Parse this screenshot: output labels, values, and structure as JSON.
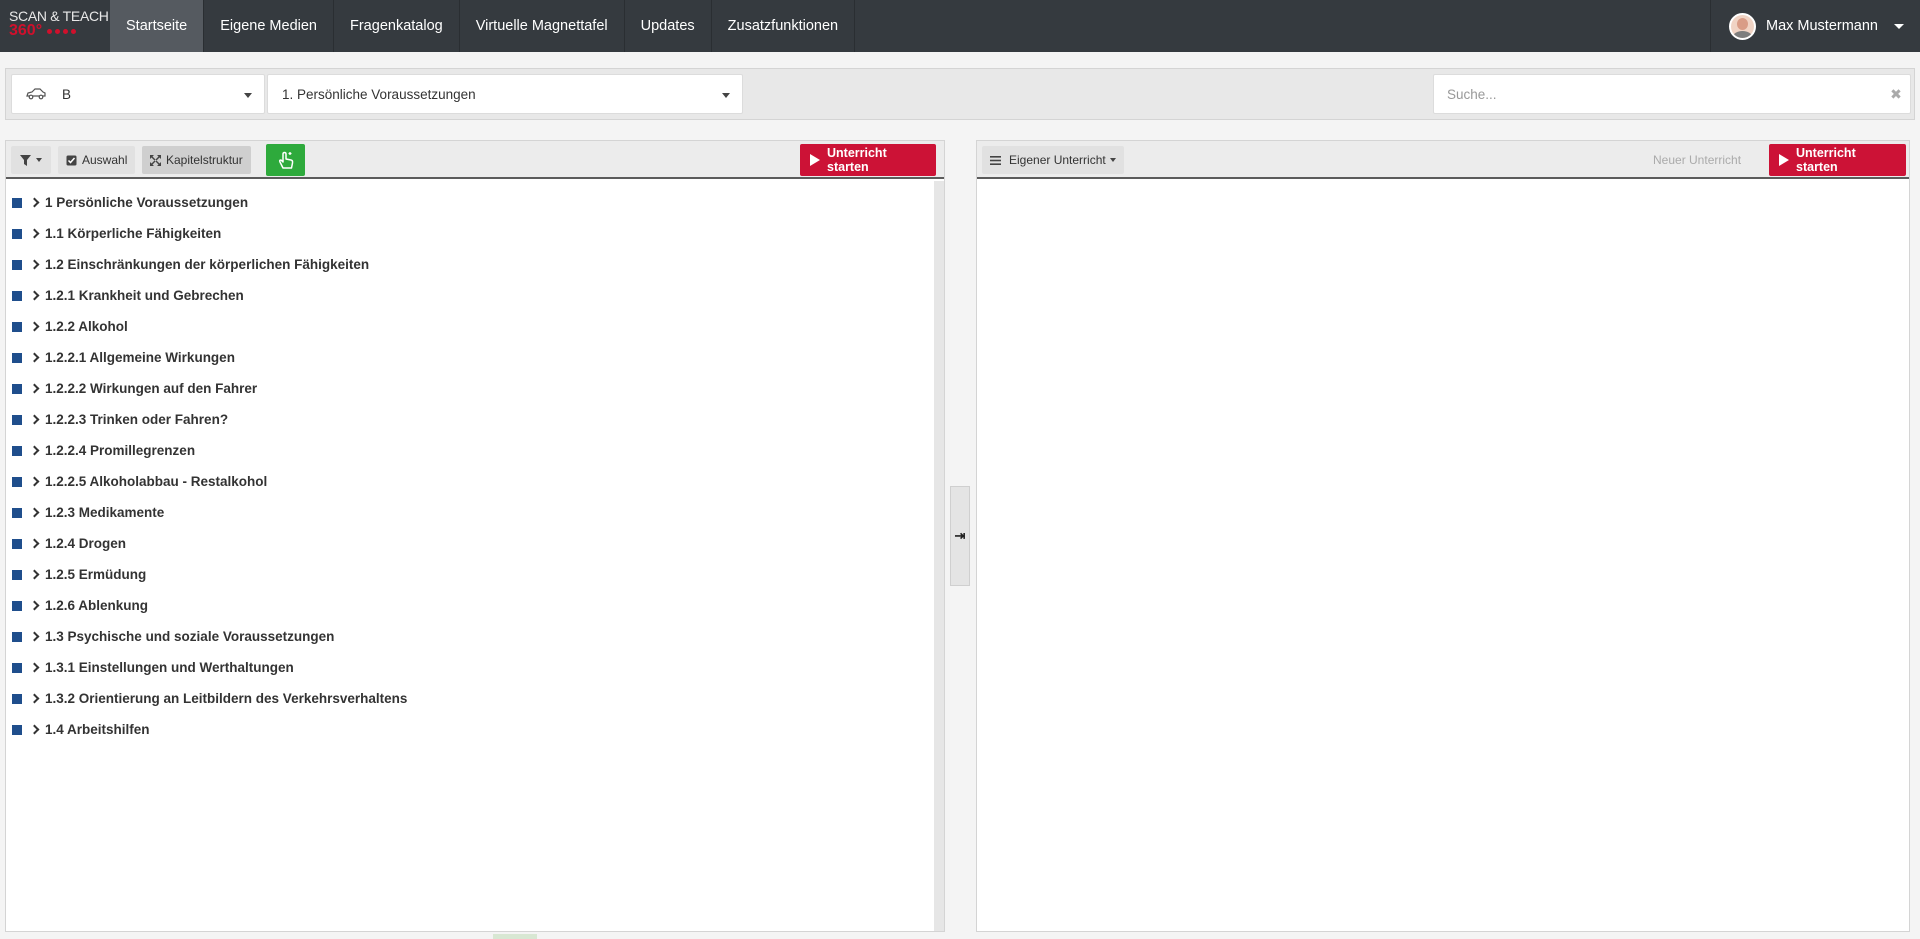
{
  "brand": {
    "line1": "SCAN & TEACH",
    "line2": "360°"
  },
  "nav": {
    "items": [
      "Startseite",
      "Eigene Medien",
      "Fragenkatalog",
      "Virtuelle Magnettafel",
      "Updates",
      "Zusatzfunktionen"
    ],
    "active": "Startseite"
  },
  "user": {
    "name": "Max Mustermann"
  },
  "filters": {
    "class_select": "B",
    "chapter_select": "1. Persönliche Voraussetzungen",
    "search_placeholder": "Suche..."
  },
  "left_panel": {
    "filter_label": "",
    "auswahl_label": "Auswahl",
    "kapitel_label": "Kapitelstruktur",
    "start_label": "Unterricht starten"
  },
  "tree": [
    "1 Persönliche Voraussetzungen",
    "1.1 Körperliche Fähigkeiten",
    "1.2 Einschränkungen der körperlichen Fähigkeiten",
    "1.2.1 Krankheit und Gebrechen",
    "1.2.2 Alkohol",
    "1.2.2.1 Allgemeine Wirkungen",
    "1.2.2.2 Wirkungen auf den Fahrer",
    "1.2.2.3 Trinken oder Fahren?",
    "1.2.2.4 Promillegrenzen",
    "1.2.2.5 Alkoholabbau - Restalkohol",
    "1.2.3 Medikamente",
    "1.2.4 Drogen",
    "1.2.5 Ermüdung",
    "1.2.6 Ablenkung",
    "1.3 Psychische und soziale Voraussetzungen",
    "1.3.1 Einstellungen und Werthaltungen",
    "1.3.2 Orientierung an Leitbildern des Verkehrsverhaltens",
    "1.4 Arbeitshilfen"
  ],
  "right_panel": {
    "menu_label": "Eigener Unterricht",
    "new_label": "Neuer Unterricht",
    "start_label": "Unterricht starten"
  },
  "colors": {
    "navbar": "#353a3f",
    "accent_red": "#cc1236",
    "accent_green": "#2eaa3c",
    "tree_square": "#1f4e8c"
  }
}
